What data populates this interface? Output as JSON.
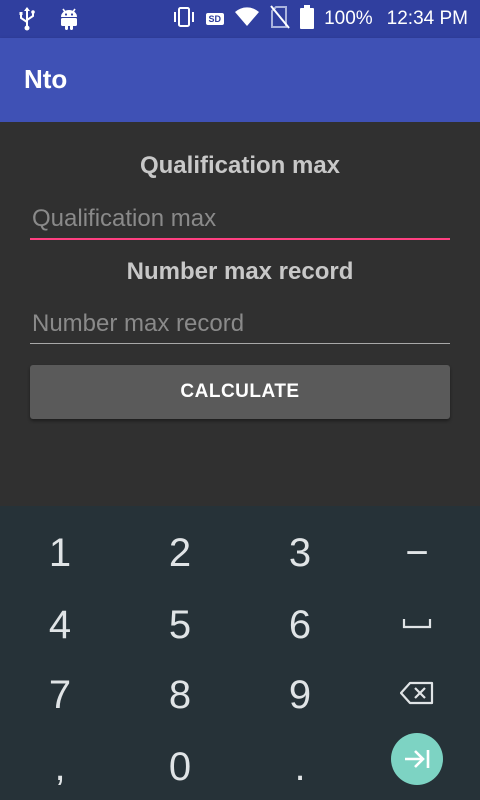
{
  "status_bar": {
    "battery": "100%",
    "time": "12:34 PM",
    "sd_label": "SD",
    "icons": [
      "usb-icon",
      "android-icon",
      "vibrate-icon",
      "sd-card-icon",
      "wifi-icon",
      "no-sim-icon",
      "battery-icon"
    ]
  },
  "app_bar": {
    "title": "Nto"
  },
  "form": {
    "qualification_label": "Qualification max",
    "qualification_placeholder": "Qualification max",
    "qualification_value": "",
    "record_label": "Number max record",
    "record_placeholder": "Number max record",
    "record_value": "",
    "calculate_label": "CALCULATE"
  },
  "keyboard": {
    "keys": {
      "k1": "1",
      "k2": "2",
      "k3": "3",
      "minus": "−",
      "k4": "4",
      "k5": "5",
      "k6": "6",
      "k7": "7",
      "k8": "8",
      "k9": "9",
      "comma": ",",
      "k0": "0",
      "period": "."
    },
    "special_icons": [
      "space-key-icon",
      "backspace-icon",
      "enter-tab-icon"
    ]
  },
  "colors": {
    "status_bar": "#303f9f",
    "app_bar": "#3f51b5",
    "background": "#303030",
    "accent": "#ff4081",
    "button": "#5a5a5a",
    "keyboard_bg": "#263238",
    "enter_key": "#7dd3c3"
  }
}
